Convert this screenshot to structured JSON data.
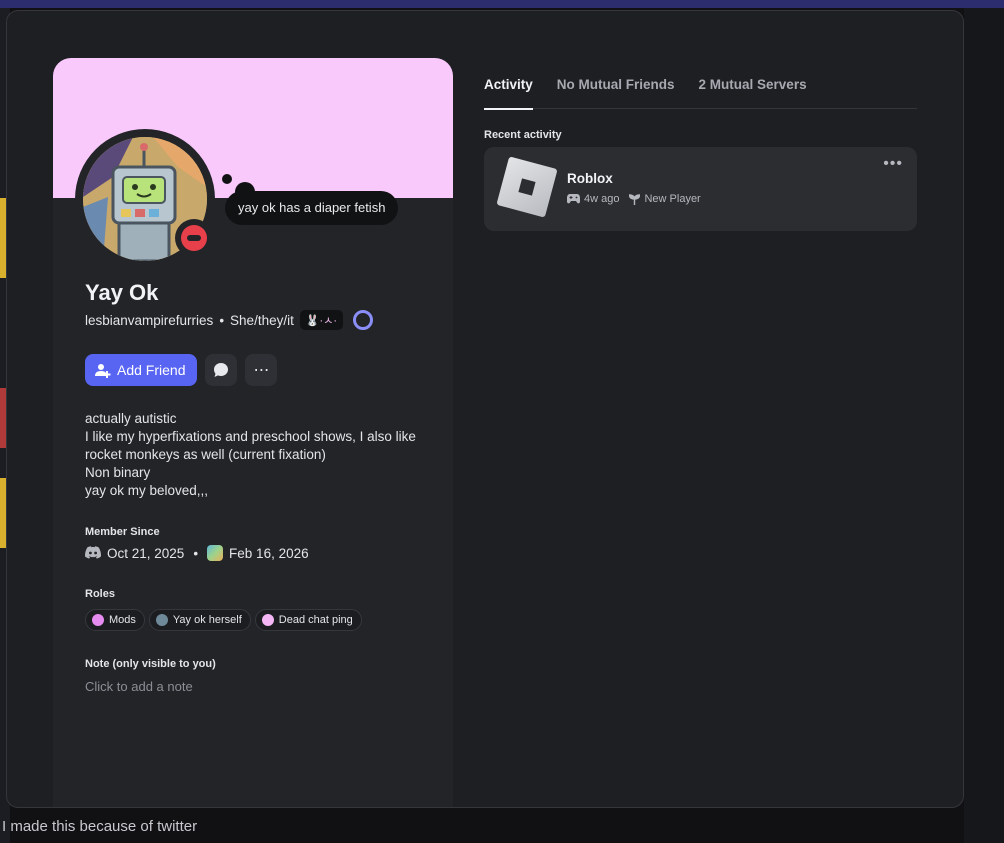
{
  "background": {
    "bottom_text": "I made this because of twitter"
  },
  "profile": {
    "status_bubble": "yay ok has a diaper fetish",
    "display_name": "Yay Ok",
    "username": "lesbianvampirefurries",
    "pronouns": "She/they/it",
    "separator": "•",
    "tag_text": "🐰·ㅅ·",
    "add_friend_label": "Add Friend",
    "bio_lines": [
      "actually autistic",
      "I like my hyperfixations and preschool shows, I also like",
      "rocket monkeys as well (current fixation)",
      "Non binary",
      "yay ok my beloved,,,"
    ],
    "member_since_title": "Member Since",
    "discord_date": "Oct 21, 2025",
    "server_date": "Feb 16, 2026",
    "roles_title": "Roles",
    "roles": [
      {
        "name": "Mods",
        "color": "#e68cf0"
      },
      {
        "name": "Yay ok herself",
        "color": "#6e8a99"
      },
      {
        "name": "Dead chat ping",
        "color": "#f4b6f4"
      }
    ],
    "note_title": "Note (only visible to you)",
    "note_placeholder": "Click to add a note"
  },
  "tabs": [
    {
      "label": "Activity"
    },
    {
      "label": "No Mutual Friends"
    },
    {
      "label": "2 Mutual Servers"
    }
  ],
  "activity": {
    "section_title": "Recent activity",
    "game": "Roblox",
    "time_ago": "4w ago",
    "badge": "New Player"
  },
  "colors": {
    "banner": "#f9c9fb",
    "accent": "#5865f2",
    "status_dnd": "#e8404a"
  }
}
